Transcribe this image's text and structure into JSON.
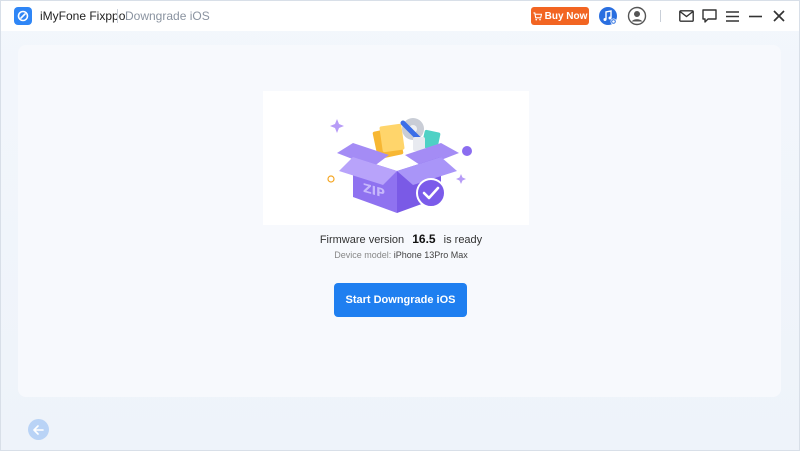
{
  "titlebar": {
    "app_name": "iMyFone Fixppo",
    "breadcrumb": "Downgrade iOS",
    "buy_label": "Buy Now"
  },
  "icons": {
    "app_logo": "fixppo-logo-icon",
    "cart": "cart-icon",
    "music": "music-icon",
    "user": "user-icon",
    "mail": "mail-icon",
    "feedback": "chat-icon",
    "menu": "menu-icon",
    "minimize": "minimize-icon",
    "close": "close-icon",
    "back": "back-arrow-icon",
    "zip_box": "zip-box-illustration"
  },
  "main": {
    "firmware_prefix": "Firmware version",
    "firmware_version": "16.5",
    "firmware_suffix": "is ready",
    "device_label": "Device model:",
    "device_value": "iPhone 13Pro Max",
    "start_button": "Start Downgrade iOS",
    "box_text": "ZIP"
  },
  "colors": {
    "accent": "#1f7ff0",
    "buy": "#f26522",
    "box": "#8b6df0",
    "check": "#7b5bea"
  }
}
